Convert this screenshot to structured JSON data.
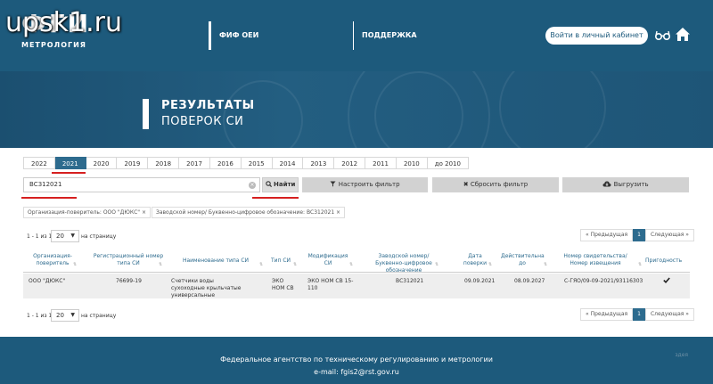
{
  "watermark": "upsk1.ru",
  "header": {
    "logo_mark": "ФГИ",
    "logo_sub": "МЕТРОЛОГИЯ",
    "nav_fif": "ФИФ ОЕИ",
    "nav_support": "ПОДДЕРЖКА",
    "login": "Войти в личный кабинет"
  },
  "banner": {
    "title1": "РЕЗУЛЬТАТЫ",
    "title2": "ПОВЕРОК СИ"
  },
  "years": [
    "2022",
    "2021",
    "2020",
    "2019",
    "2018",
    "2017",
    "2016",
    "2015",
    "2014",
    "2013",
    "2012",
    "2011",
    "2010",
    "до 2010"
  ],
  "active_year": "2021",
  "search": {
    "value": "ВС312021",
    "find": "Найти",
    "filter": "Настроить фильтр",
    "reset": "Сбросить фильтр",
    "export": "Выгрузить"
  },
  "chips": {
    "org": "Организация-поверитель: ООО \"ДЮКС\" ×",
    "serial": "Заводской номер/ Буквенно-цифровое обозначение: ВС312021 ×"
  },
  "pager": {
    "info": "1 - 1 из 1",
    "per_page": "20",
    "per_page_label": "на страницу",
    "prev": "« Предыдущая",
    "page": "1",
    "next": "Следующая »"
  },
  "table": {
    "headers": [
      "Организация-поверитель",
      "Регистрационный номер типа СИ",
      "Наименование типа СИ",
      "Тип СИ",
      "Модификация СИ",
      "Заводской номер/ Буквенно-цифровое обозначение",
      "Дата поверки",
      "Действительна до",
      "Номер свидетельства/ Номер извещения",
      "Пригодность"
    ],
    "row": {
      "org": "ООО \"ДЮКС\"",
      "reg": "76699-19",
      "name": "Счетчики воды сухоходные крыльчатые универсальные",
      "type": "ЭКО НОМ СВ",
      "mod": "ЭКО НОМ СВ 15-110",
      "serial": "ВС312021",
      "date": "09.09.2021",
      "valid": "08.09.2027",
      "cert": "С-ГЯО/09-09-2021/93116303"
    }
  },
  "footer": {
    "line1": "Федеральное агентство по техническому регулированию и метрологии",
    "line2": "e-mail: fgis2@rst.gov.ru",
    "note": "здея"
  }
}
